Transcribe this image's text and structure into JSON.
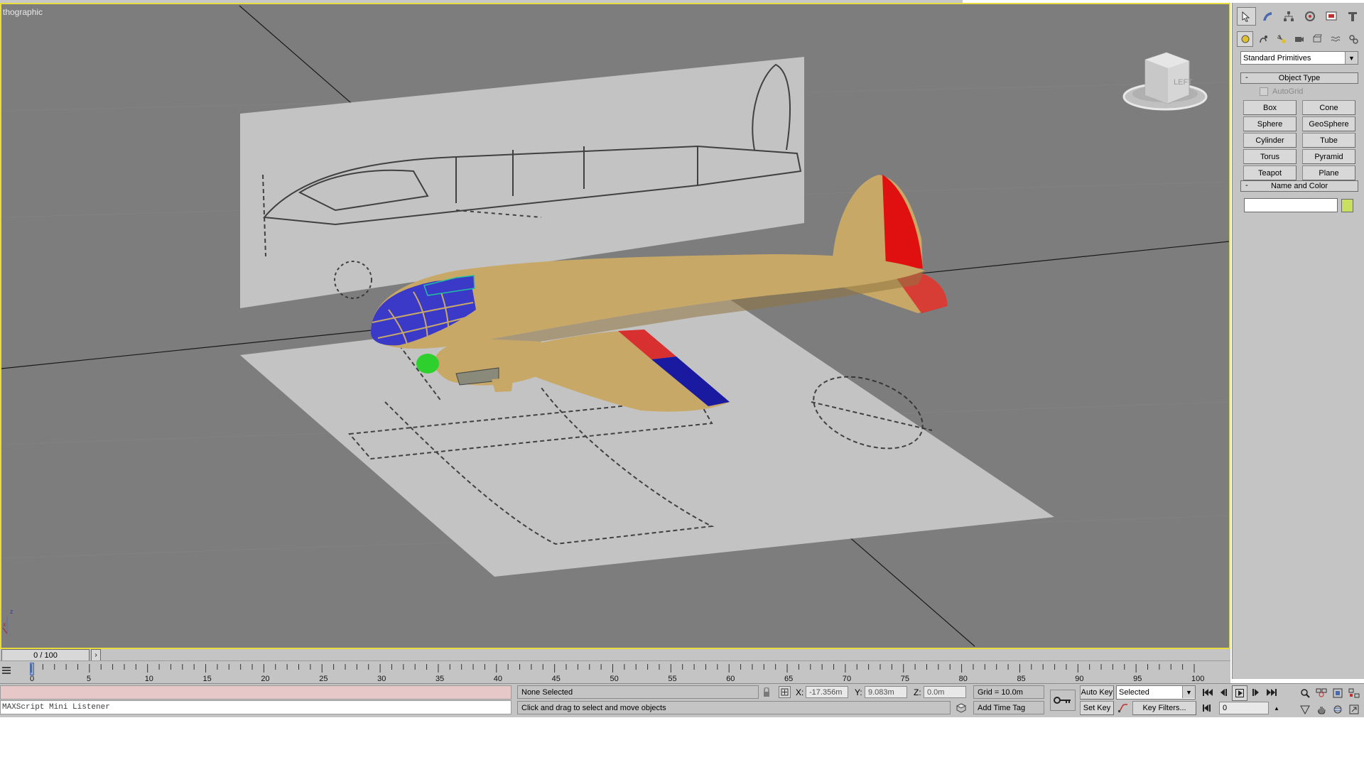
{
  "viewport": {
    "label": "thographic",
    "viewcube_label": "LEFT",
    "axis_z": "z",
    "axis_x": "x"
  },
  "command_panel": {
    "tab_icons": [
      "pointer-icon",
      "modify-icon",
      "hierarchy-icon",
      "motion-icon",
      "display-icon",
      "utilities-icon"
    ],
    "subtab_icons": [
      "geometry-icon",
      "shapes-icon",
      "lights-icon",
      "cameras-icon",
      "helpers-icon",
      "spacewarps-icon",
      "systems-icon"
    ],
    "category": "Standard Primitives",
    "object_type": {
      "title": "Object Type",
      "autogrid": "AutoGrid",
      "buttons": [
        "Box",
        "Cone",
        "Sphere",
        "GeoSphere",
        "Cylinder",
        "Tube",
        "Torus",
        "Pyramid",
        "Teapot",
        "Plane"
      ]
    },
    "name_and_color": {
      "title": "Name and Color",
      "name_value": "",
      "color": "#c8e060"
    }
  },
  "timeline": {
    "slider_label": "0 / 100",
    "ticks": [
      "0",
      "5",
      "10",
      "15",
      "20",
      "25",
      "30",
      "35",
      "40",
      "45",
      "50",
      "55",
      "60",
      "65",
      "70",
      "75",
      "80",
      "85",
      "90",
      "95",
      "100"
    ]
  },
  "status": {
    "maxscript_label": "MAXScript Mini Listener",
    "selection": "None Selected",
    "prompt": "Click and drag to select and move objects",
    "x_label": "X:",
    "x_value": "-17.356m",
    "y_label": "Y:",
    "y_value": "9.083m",
    "z_label": "Z:",
    "z_value": "0.0m",
    "grid": "Grid = 10.0m",
    "add_time_tag": "Add Time Tag",
    "auto_key": "Auto Key",
    "set_key": "Set Key",
    "key_mode": "Selected",
    "key_filters": "Key Filters...",
    "frame": "0"
  },
  "colors": {
    "viewport_bg": "#7d7d7d",
    "active_border": "#e8dc3c",
    "fuselage": "#c8a866",
    "canopy": "#3b3ac8",
    "spinner": "#2ed02e",
    "rudder": "#e01010",
    "wing_red": "#d83030",
    "wing_blue": "#1a1aa0"
  }
}
